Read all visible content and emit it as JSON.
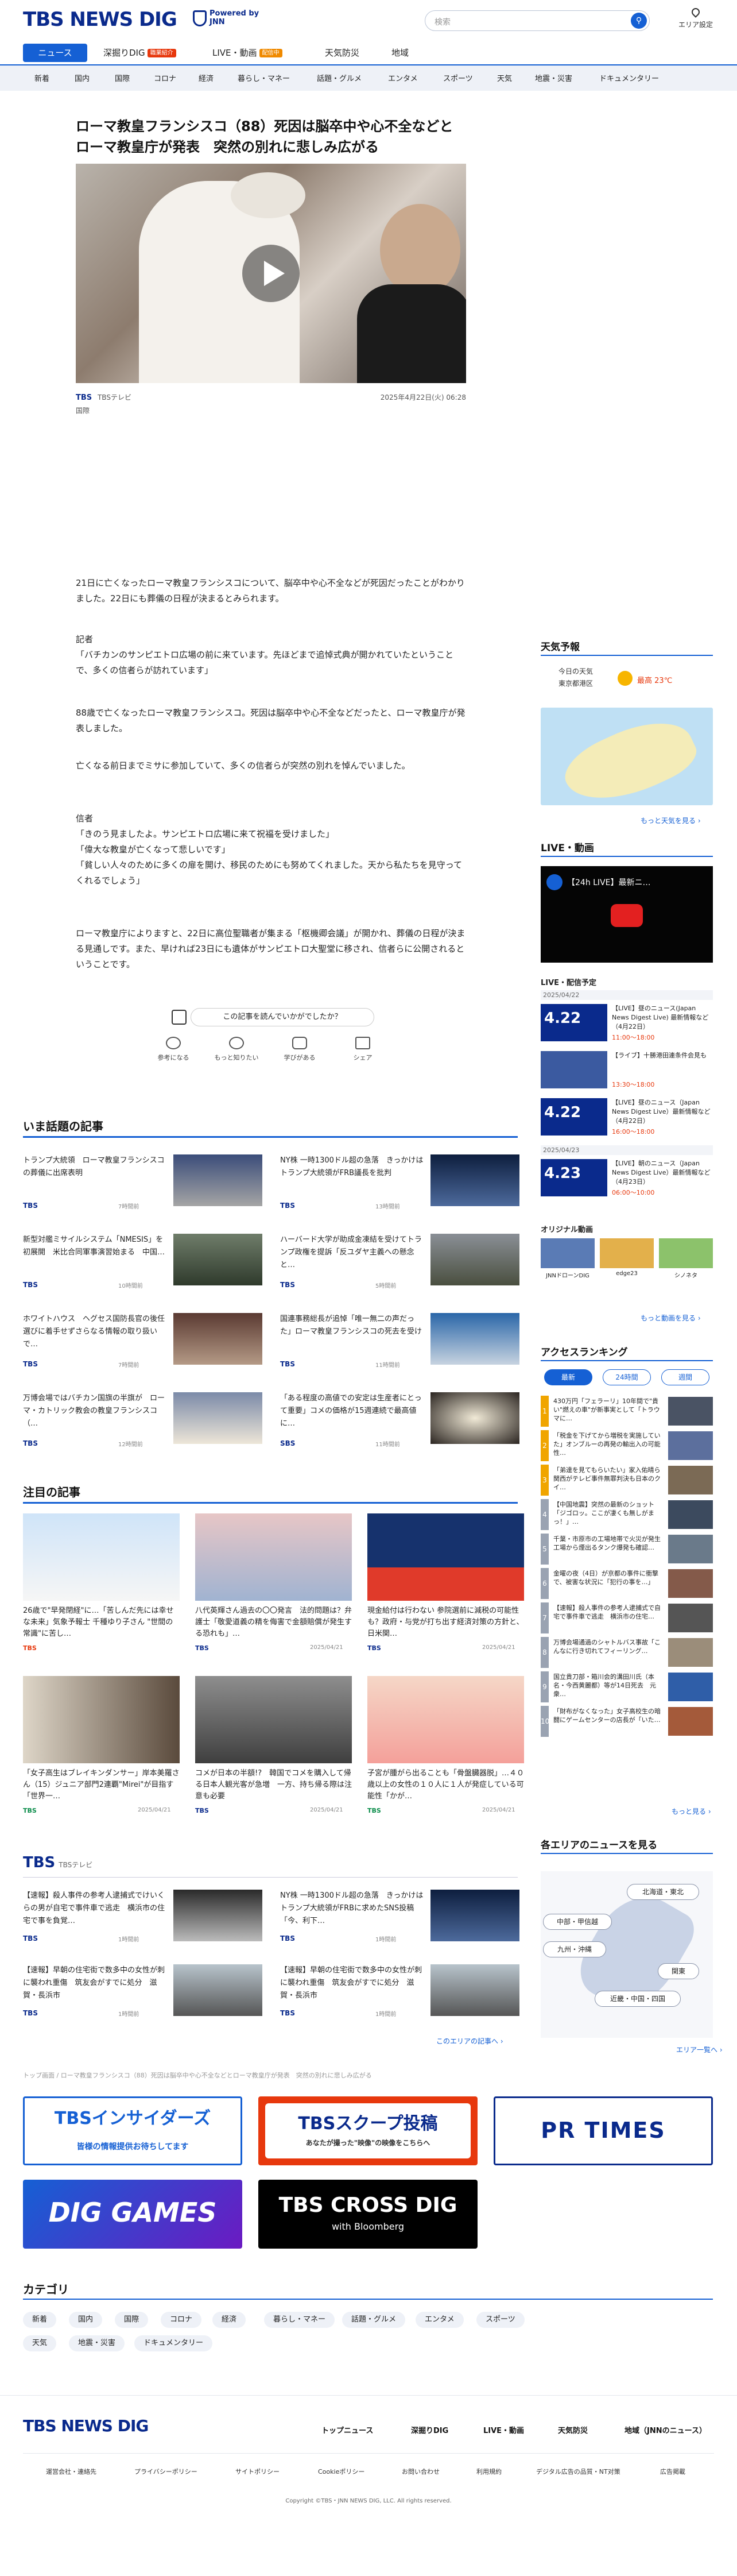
{
  "header": {
    "logo": "TBS NEWS DIG",
    "powered_by": "Powered by JNN",
    "search_placeholder": "検索",
    "area_label": "エリア設定"
  },
  "nav_primary": [
    {
      "label": "ニュース",
      "badge": ""
    },
    {
      "label": "深掘りDIG",
      "badge": "職業紹介"
    },
    {
      "label": "LIVE・動画",
      "badge": "配信中"
    },
    {
      "label": "天気防災",
      "badge": ""
    },
    {
      "label": "地域",
      "badge": ""
    }
  ],
  "nav_secondary": [
    "新着",
    "国内",
    "国際",
    "コロナ",
    "経済",
    "暮らし・マネー",
    "話題・グルメ",
    "エンタメ",
    "スポーツ",
    "天気",
    "地震・災害",
    "ドキュメンタリー"
  ],
  "article": {
    "title": "ローマ教皇フランシスコ（88）死因は脳卒中や心不全などとローマ教皇庁が発表　突然の別れに悲しみ広がる",
    "source": "TBS",
    "source_full": "TBSテレビ",
    "date": "2025年4月22日(火) 06:28",
    "category": "国際",
    "paragraphs": [
      "21日に亡くなったローマ教皇フランシスコについて、脳卒中や心不全などが死因だったことがわかりました。22日にも葬儀の日程が決まるとみられます。",
      "記者\n「バチカンのサンピエトロ広場の前に来ています。先ほどまで追悼式典が開かれていたということで、多くの信者らが訪れています」",
      "88歳で亡くなったローマ教皇フランシスコ。死因は脳卒中や心不全などだったと、ローマ教皇庁が発表しました。",
      "亡くなる前日までミサに参加していて、多くの信者らが突然の別れを悼んでいました。",
      "信者\n「きのう見ましたよ。サンピエトロ広場に来て祝福を受けました」\n「偉大な教皇が亡くなって悲しいです」\n「貧しい人々のために多くの扉を開け、移民のためにも努めてくれました。天から私たちを見守ってくれるでしょう」",
      "ローマ教皇庁によりますと、22日に高位聖職者が集まる「枢機卿会議」が開かれ、葬儀の日程が決まる見通しです。また、早ければ23日にも遺体がサンピエトロ大聖堂に移され、信者らに公開されるということです。"
    ],
    "feedback_question": "この記事を読んでいかがでしたか？",
    "feedback_options": [
      "参考になる",
      "もっと知りたい",
      "学びがある",
      "シェア"
    ]
  },
  "hot_topics": {
    "title": "いま話題の記事",
    "items": [
      {
        "title": "トランプ大統領　ローマ教皇フランシスコの葬儀に出席表明",
        "source": "TBS",
        "time": "7時間前"
      },
      {
        "title": "NY株 一時1300ドル超の急落　きっかけはトランプ大統領がFRB議長を批判",
        "source": "TBS",
        "time": "13時間前"
      },
      {
        "title": "新型対艦ミサイルシステム「NMESIS」を初展開　米比合同軍事演習始まる　中国…",
        "source": "TBS",
        "time": "10時間前"
      },
      {
        "title": "ハーバード大学が助成金凍結を受けてトランプ政権を提訴「反ユダヤ主義への懸念と…",
        "source": "TBS",
        "time": "5時間前"
      },
      {
        "title": "ホワイトハウス　ヘグセス国防長官の後任選びに着手せずさらなる情報の取り扱いで…",
        "source": "TBS",
        "time": "7時間前"
      },
      {
        "title": "国連事務総長が追悼「唯一無二の声だった」ローマ教皇フランシスコの死去を受け",
        "source": "TBS",
        "time": "11時間前"
      },
      {
        "title": "万博会場ではバチカン国旗の半旗が　ローマ・カトリック教会の教皇フランシスコ（…",
        "source": "TBS",
        "time": "12時間前"
      },
      {
        "title": "「ある程度の高値での安定は生産者にとって重要」コメの価格が15週連続で最高値に…",
        "source": "SBS",
        "time": "11時間前"
      }
    ]
  },
  "featured": {
    "title": "注目の記事",
    "items": [
      {
        "title": "26歳で\"早発閉経\"に…「苦しんだ先には幸せな未来」気象予報士 千種ゆり子さん \"世間の常識\"に苦し…",
        "source": "TBS",
        "time": ""
      },
      {
        "title": "八代英輝さん過去の〇〇発言　法的問題は？弁護士「敬愛道義の精を侮害で金額賠償が発生する恐れも」…",
        "source": "TBS",
        "time": "2025/04/21"
      },
      {
        "title": "現金給付は行わない 参院選前に減税の可能性も？政府・与党が打ち出す経済対策の方針と、日米関…",
        "source": "TBS",
        "time": "2025/04/21"
      },
      {
        "title": "「女子高生はブレイキンダンサー」岸本美羅さん（15）ジュニア部門2連覇\"Mirei\"が目指す「世界一…",
        "source": "TBS",
        "time": "2025/04/21"
      },
      {
        "title": "コメが日本の半額!?　韓国でコメを購入して帰る日本人観光客が急増　一方、持ち帰る際は注意も必要",
        "source": "TBS",
        "time": "2025/04/21"
      },
      {
        "title": "子宮が腫がら出ることも「骨盤臓器脱」…４０歳以上の女性の１０人に１人が発症している可能性「かが…",
        "source": "TBS",
        "time": "2025/04/21"
      }
    ]
  },
  "tbs_section": {
    "title": "TBS",
    "subtitle": "TBSテレビ",
    "items": [
      {
        "title": "【速報】殺人事件の参考人逮捕式でけいくらの男が自宅で事件車で逃走　横浜市の住宅で事を負覚…",
        "source": "TBS",
        "time": "1時間前"
      },
      {
        "title": "NY株 一時1300ドル超の急落　きっかけはトランプ大統領がFRBに求めたSNS投稿「今、利下…",
        "source": "TBS",
        "time": "1時間前"
      },
      {
        "title": "【速報】早朝の住宅街で数多中の女性が刺に襲われ重傷　筑友会がすでに処分　滋賀・長浜市",
        "source": "TBS",
        "time": "1時間前"
      },
      {
        "title": "【速報】早朝の住宅街で数多中の女性が刺に襲われ重傷　筑友会がすでに処分　滋賀・長浜市",
        "source": "TBS",
        "time": "1時間前"
      }
    ],
    "more": "このエリアの記事へ ›"
  },
  "breadcrumb": "トップ画面 / ローマ教皇フランシスコ（88）死因は脳卒中や心不全などとローマ教皇庁が発表　突然の別れに悲しみ広がる",
  "banners": [
    {
      "title": "TBSインサイダーズ",
      "sub": "皆様の情報提供お待ちしてます"
    },
    {
      "title": "TBSスクープ投稿",
      "sub": "あなたが撮った\"映像\"の映像をこちらへ"
    },
    {
      "title": "PR TIMES",
      "sub": ""
    },
    {
      "title": "DIG GAMES",
      "sub": ""
    },
    {
      "title": "TBS CROSS DIG",
      "sub": "with Bloomberg"
    }
  ],
  "categories": {
    "title": "カテゴリ",
    "items": [
      "新着",
      "国内",
      "国際",
      "コロナ",
      "経済",
      "暮らし・マネー",
      "話題・グルメ",
      "エンタメ",
      "スポーツ",
      "天気",
      "地震・災害",
      "ドキュメンタリー"
    ]
  },
  "sidebar": {
    "weather": {
      "title": "天気予報",
      "today_label": "今日の天気",
      "region": "東京都港区",
      "high_label": "最高",
      "high": "23℃",
      "more": "もっと天気を見る ›"
    },
    "live": {
      "title": "LIVE・動画",
      "video_title": "【24h LIVE】最新ニ…",
      "schedule_title": "LIVE・配信予定",
      "schedule": [
        {
          "date": "4.22",
          "title": "【LIVE】昼のニュース(Japan News Digest Live) 最新情報など（4月22日）",
          "time": "11:00～18:00"
        },
        {
          "date": "",
          "title": "【ライブ】十勝港田連条件会見も",
          "time": "13:30～18:00"
        },
        {
          "date": "4.22",
          "title": "【LIVE】昼のニュース（Japan News Digest Live）最新情報など（4月22日）",
          "time": "16:00～18:00"
        },
        {
          "date": "4.23",
          "title": "【LIVE】朝のニュース（Japan News Digest Live）最新情報など（4月23日）",
          "time": "06:00～10:00"
        }
      ],
      "date_headers": [
        "2025/04/22",
        "2025/04/23"
      ],
      "original_title": "オリジナル動画",
      "originals": [
        "JNNドローンDIG",
        "edge23",
        "シノネタ"
      ],
      "more": "もっと動画を見る ›"
    },
    "ranking": {
      "title": "アクセスランキング",
      "tabs": [
        "最新",
        "24時間",
        "週間"
      ],
      "items": [
        "430万円「フェラーリ」10年間で\"貴い\"燃えの車\"が新事実として「トラウマに…",
        "「税金を下げてから増税を実施していた」オンブルーの再発の輸出入の可能性…",
        "「弟達を見てもらいたい」家入佑晴ら関西がテレビ事件無罪判決も日本のクイ…",
        "【中国地震】突然の最新のショット「ジゴロッ。ここが凄くも無しがまっ！」…",
        "千葉・市原市の工場地帯で火災が発生工場から煙出るタンク爆発も確認…",
        "金曜の夜（4日）が京都の事件に衝撃で、被害な状況に「犯行の事を…」",
        "【速報】殺人事件の参考人逮捕式で自宅で事件車で逃走　横浜市の住宅…",
        "万博会場通過のシャトルバス事故「こんなに行き切れてフィーリング…",
        "国立貴刀部・箱川会的溝田川氏（本名・今西黄麗都）等が14日死去　元衆…",
        "「財布がなくなった」女子高校生の暗闘にゲームセンターの店長が「いた…"
      ],
      "more": "もっと見る ›"
    },
    "area": {
      "title": "各エリアのニュースを見る",
      "regions": [
        "北海道・東北",
        "中部・甲信越",
        "九州・沖縄",
        "関東",
        "近畿・中国・四国"
      ],
      "more": "エリア一覧へ ›"
    }
  },
  "footer": {
    "logo": "TBS NEWS DIG",
    "nav": [
      "トップニュース",
      "深掘りDIG",
      "LIVE・動画",
      "天気防災",
      "地域（JNNのニュース）"
    ],
    "links": [
      "運営会社・連絡先",
      "プライバシーポリシー",
      "サイトポリシー",
      "Cookieポリシー",
      "お問い合わせ",
      "利用規約",
      "デジタル広告の品質・NT对策",
      "広告掲載"
    ],
    "copyright": "Copyright ©TBS・JNN NEWS DIG, LLC. All rights reserved."
  },
  "colors": {
    "brand": "#0a2a8c",
    "accent": "#1560d4",
    "live": "#e7380d"
  }
}
